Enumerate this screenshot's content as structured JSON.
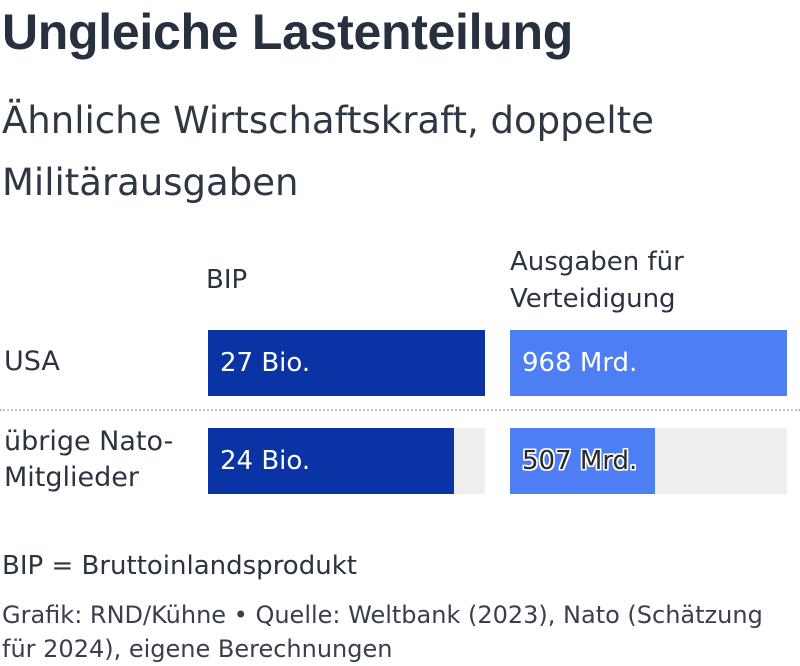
{
  "title": "Ungleiche Lastenteilung",
  "subtitle": "Ähnliche Wirtschaftskraft, doppelte Militärausgaben",
  "columns": {
    "gdp": "BIP",
    "defense": "Ausgaben für Verteidigung"
  },
  "colors": {
    "gdp": "#0a34a6",
    "defense": "#4d7ef4",
    "track": "#eeeeee"
  },
  "chart_data": {
    "type": "bar",
    "categories": [
      "USA",
      "übrige Nato-Mitglieder"
    ],
    "series": [
      {
        "name": "BIP",
        "values": [
          27,
          24
        ],
        "labels": [
          "27 Bio.",
          "24 Bio."
        ]
      },
      {
        "name": "Ausgaben für Verteidigung",
        "values": [
          968,
          507
        ],
        "labels": [
          "968 Mrd.",
          "507 Mrd."
        ]
      }
    ]
  },
  "note": "BIP = Bruttoinlandsprodukt",
  "source": "Grafik: RND/Kühne • Quelle: Weltbank (2023), Nato (Schätzung für 2024), eigene Berechnungen"
}
